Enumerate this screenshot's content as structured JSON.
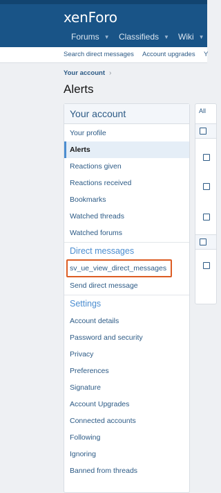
{
  "header": {
    "logo": "xenForo",
    "nav": [
      {
        "label": "Forums",
        "arrow": "▼"
      },
      {
        "label": "Classifieds",
        "arrow": "▼"
      },
      {
        "label": "Wiki",
        "arrow": "▼"
      }
    ]
  },
  "subnav": {
    "links": [
      "Search direct messages",
      "Account upgrades",
      "Y"
    ]
  },
  "breadcrumb": {
    "item": "Your account",
    "sep": "›"
  },
  "page_title": "Alerts",
  "sidebar": {
    "title": "Your account",
    "items": [
      {
        "label": "Your profile"
      },
      {
        "label": "Alerts",
        "active": true
      },
      {
        "label": "Reactions given"
      },
      {
        "label": "Reactions received"
      },
      {
        "label": "Bookmarks"
      },
      {
        "label": "Watched threads"
      },
      {
        "label": "Watched forums"
      }
    ],
    "dm_section": "Direct messages",
    "dm_items": [
      {
        "label": "sv_ue_view_direct_messages"
      },
      {
        "label": "Send direct message"
      }
    ],
    "settings_section": "Settings",
    "settings_items": [
      {
        "label": "Account details"
      },
      {
        "label": "Password and security"
      },
      {
        "label": "Privacy"
      },
      {
        "label": "Preferences"
      },
      {
        "label": "Signature"
      },
      {
        "label": "Account Upgrades"
      },
      {
        "label": "Connected accounts"
      },
      {
        "label": "Following"
      },
      {
        "label": "Ignoring"
      },
      {
        "label": "Banned from threads"
      }
    ]
  },
  "right_panel": {
    "tab": "All"
  },
  "colors": {
    "header_bg": "#195487",
    "link": "#2c5a85",
    "accent": "#4b8dd0",
    "highlight_border": "#dc5c23"
  }
}
